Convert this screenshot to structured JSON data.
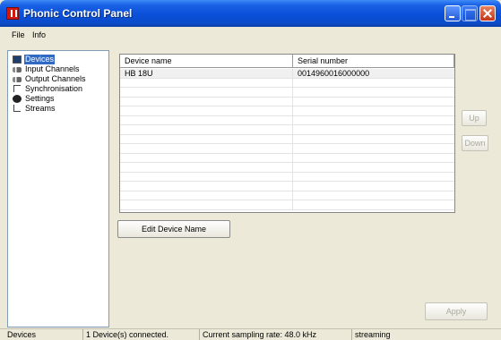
{
  "window": {
    "title": "Phonic Control Panel"
  },
  "menu": {
    "file": "File",
    "info": "Info"
  },
  "tree": {
    "items": [
      {
        "label": "Devices",
        "icon": "device-icon",
        "selected": true
      },
      {
        "label": "Input Channels",
        "icon": "input-channels-icon"
      },
      {
        "label": "Output Channels",
        "icon": "output-channels-icon"
      },
      {
        "label": "Synchronisation",
        "icon": "sync-icon"
      },
      {
        "label": "Settings",
        "icon": "settings-icon"
      },
      {
        "label": "Streams",
        "icon": "streams-icon"
      }
    ]
  },
  "table": {
    "headers": {
      "name": "Device name",
      "serial": "Serial number"
    },
    "rows": [
      {
        "name": "HB 18U",
        "serial": "0014960016000000"
      }
    ]
  },
  "buttons": {
    "edit": "Edit Device Name",
    "up": "Up",
    "down": "Down",
    "apply": "Apply"
  },
  "status": {
    "section": "Devices",
    "devices": "1 Device(s) connected.",
    "sampling": "Current sampling rate: 48.0 kHz",
    "state": "streaming"
  }
}
